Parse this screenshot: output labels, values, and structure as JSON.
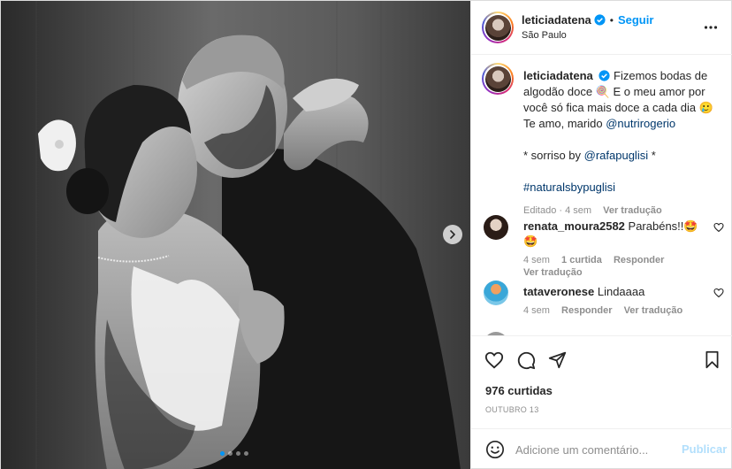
{
  "post": {
    "username": "leticiadatena",
    "follow_label": "Seguir",
    "separator": "•",
    "location": "São Paulo",
    "verified_icon": "verified-badge-icon",
    "more_icon": "more-options-icon"
  },
  "caption": {
    "username": "leticiadatena",
    "text_1": "Fizemos bodas de algodão doce 🍭 E o meu amor por você só fica mais doce a cada dia 🥲 Te amo, marido ",
    "mention_1": "@nutrirogerio",
    "text_2": "* sorriso by ",
    "mention_2": "@rafapuglisi",
    "text_3": " *",
    "hashtag": "#naturalsbypuglisi",
    "edited": "Editado · 4 sem",
    "translate": "Ver tradução"
  },
  "comments": [
    {
      "username": "renata_moura2582",
      "text": "Parabéns!!🤩🤩",
      "time": "4 sem",
      "likes": "1 curtida",
      "reply": "Responder",
      "translate": "Ver tradução"
    },
    {
      "username": "tataveronese",
      "text": "Lindaaaa",
      "time": "4 sem",
      "reply": "Responder",
      "translate": "Ver tradução"
    }
  ],
  "actions": {
    "like_icon": "heart-icon",
    "comment_icon": "comment-icon",
    "share_icon": "share-icon",
    "save_icon": "bookmark-icon",
    "likes": "976 curtidas",
    "date": "OUTUBRO 13"
  },
  "add_comment": {
    "placeholder": "Adicione um comentário...",
    "publish": "Publicar",
    "emoji_icon": "emoji-icon"
  },
  "carousel": {
    "total": 4,
    "active": 1,
    "next_icon": "chevron-right-icon"
  },
  "colors": {
    "accent": "#0095f6",
    "text": "#262626",
    "muted": "#8e8e8e",
    "link": "#00376b",
    "publish_disabled": "#b2dffc"
  }
}
